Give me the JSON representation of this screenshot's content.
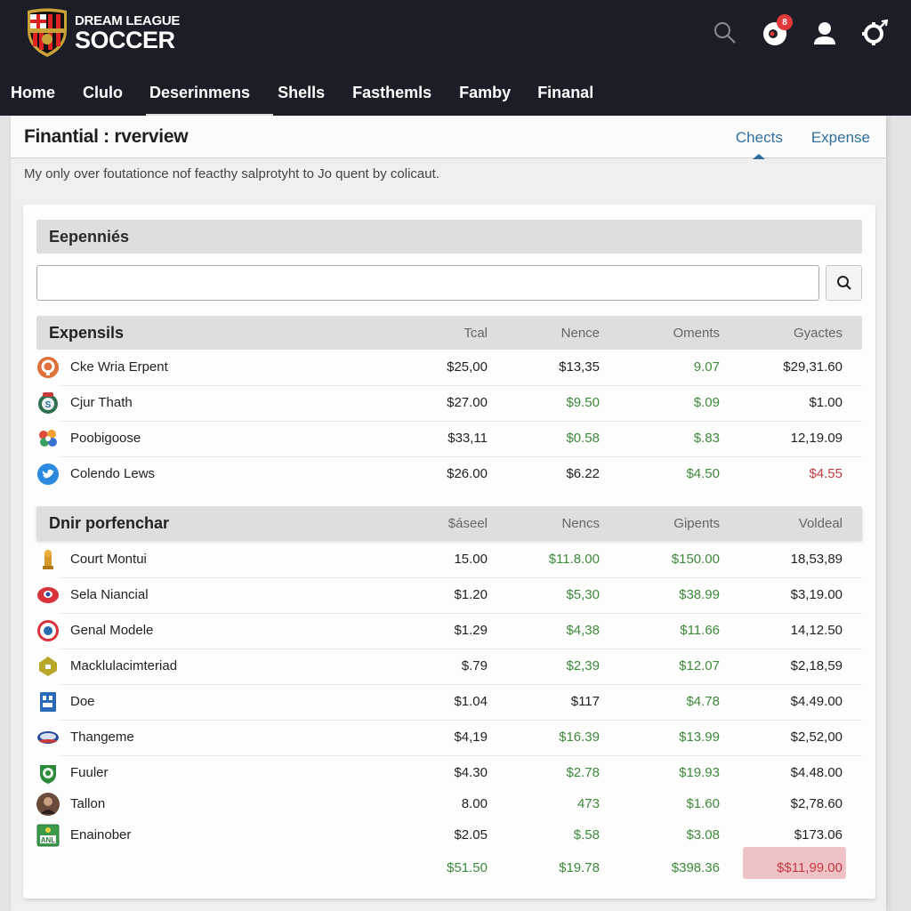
{
  "app": {
    "logo_line1": "DREAM LEAGUE",
    "logo_line2": "SOCCER",
    "notification_count": "8"
  },
  "nav": {
    "items": [
      {
        "label": "Home"
      },
      {
        "label": "Clulo"
      },
      {
        "label": "Deserinmens",
        "active": true
      },
      {
        "label": "Shells"
      },
      {
        "label": "Fasthemls"
      },
      {
        "label": "Famby"
      },
      {
        "label": "Finanal"
      }
    ]
  },
  "page": {
    "title": "Finantial : rverview",
    "subtitle": "My only over foutationce nof feacthy salprotyht to Jo quent by colicaut.",
    "tabs": [
      {
        "label": "Chects",
        "active": true
      },
      {
        "label": "Expense"
      }
    ]
  },
  "card": {
    "heading": "Eepenniés",
    "search": {
      "value": "",
      "placeholder": ""
    }
  },
  "colors": {
    "header_bg": "#1b1e26",
    "accent_blue": "#2f6f9f",
    "positive_green": "#3d8a3a",
    "negative_red": "#c23a43",
    "highlight_red_bg": "#efc2c5"
  },
  "section1": {
    "title": "Expensils",
    "columns": [
      "Tcal",
      "Nence",
      "Oments",
      "Gyactes"
    ],
    "rows": [
      {
        "icon": "orange-circle-logo-icon",
        "name": "Cke Wria Erpent",
        "values": [
          "$25,00",
          "$13,35",
          "9.07",
          "$29,31.60"
        ],
        "colors": [
          "",
          "",
          "green",
          ""
        ]
      },
      {
        "icon": "green-club-crest-icon",
        "name": "Cjur Thath",
        "values": [
          "$27.00",
          "$9.50",
          "$.09",
          "$1.00"
        ],
        "colors": [
          "",
          "green",
          "green",
          ""
        ]
      },
      {
        "icon": "colorful-flower-logo-icon",
        "name": "Poobigoose",
        "values": [
          "$33,11",
          "$0.58",
          "$.83",
          "12,19.09"
        ],
        "colors": [
          "",
          "green",
          "green",
          ""
        ]
      },
      {
        "icon": "twitter-bird-icon",
        "name": "Colendo Lews",
        "values": [
          "$26.00",
          "$6.22",
          "$4.50",
          "$4.55"
        ],
        "colors": [
          "",
          "",
          "green",
          "red"
        ]
      }
    ]
  },
  "section2": {
    "title": "Dnir porfenchar",
    "columns": [
      "$áseel",
      "Nencs",
      "Gipents",
      "Voldeal"
    ],
    "rows": [
      {
        "icon": "golden-emblem-icon",
        "name": "Court Montui",
        "values": [
          "15.00",
          "$11.8.00",
          "$150.00",
          "18,53,89"
        ],
        "colors": [
          "",
          "green",
          "green",
          ""
        ]
      },
      {
        "icon": "red-oval-logo-icon",
        "name": "Sela Niancial",
        "values": [
          "$1.20",
          "$5,30",
          "$38.99",
          "$3,19.00"
        ],
        "colors": [
          "",
          "green",
          "green",
          ""
        ]
      },
      {
        "icon": "red-round-badge-icon",
        "name": "Genal Modele",
        "values": [
          "$1.29",
          "$4,38",
          "$11.66",
          "14,12.50"
        ],
        "colors": [
          "",
          "green",
          "green",
          ""
        ]
      },
      {
        "icon": "olive-hexagon-badge-icon",
        "name": "Macklulacimteriad",
        "values": [
          "$.79",
          "$2,39",
          "$12.07",
          "$2,18,59"
        ],
        "colors": [
          "",
          "green",
          "green",
          ""
        ]
      },
      {
        "icon": "blue-square-logo-icon",
        "name": "Doe",
        "values": [
          "$1.04",
          "$117",
          "$4.78",
          "$4.49.00"
        ],
        "colors": [
          "",
          "",
          "green",
          ""
        ]
      },
      {
        "icon": "blue-oval-brand-icon",
        "name": "Thangeme",
        "values": [
          "$4,19",
          "$16.39",
          "$13.99",
          "$2,52,00"
        ],
        "colors": [
          "",
          "green",
          "green",
          ""
        ]
      },
      {
        "icon": "green-shield-crest-icon",
        "name": "Fuuler",
        "values": [
          "$4.30",
          "$2.78",
          "$19.93",
          "$4.48.00"
        ],
        "colors": [
          "",
          "green",
          "green",
          ""
        ]
      },
      {
        "icon": "person-avatar-icon",
        "name": "Tallon",
        "values": [
          "8.00",
          "473",
          "$1.60",
          "$2,78.60"
        ],
        "colors": [
          "",
          "green",
          "green",
          ""
        ]
      },
      {
        "icon": "green-sign-logo-icon",
        "name": "Enainober",
        "values": [
          "$2.05",
          "$.58",
          "$3.08",
          "$173.06"
        ],
        "colors": [
          "",
          "green",
          "green",
          ""
        ]
      }
    ],
    "totals": {
      "values": [
        "$51.50",
        "$19.78",
        "$398.36",
        "$$11,99.00"
      ],
      "colors": [
        "green",
        "green",
        "green",
        "red"
      ]
    }
  }
}
